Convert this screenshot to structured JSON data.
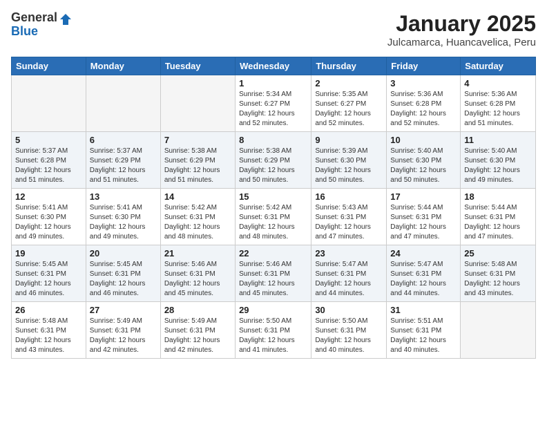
{
  "logo": {
    "general": "General",
    "blue": "Blue"
  },
  "header": {
    "month": "January 2025",
    "location": "Julcamarca, Huancavelica, Peru"
  },
  "weekdays": [
    "Sunday",
    "Monday",
    "Tuesday",
    "Wednesday",
    "Thursday",
    "Friday",
    "Saturday"
  ],
  "weeks": [
    [
      {
        "day": "",
        "info": ""
      },
      {
        "day": "",
        "info": ""
      },
      {
        "day": "",
        "info": ""
      },
      {
        "day": "1",
        "info": "Sunrise: 5:34 AM\nSunset: 6:27 PM\nDaylight: 12 hours\nand 52 minutes."
      },
      {
        "day": "2",
        "info": "Sunrise: 5:35 AM\nSunset: 6:27 PM\nDaylight: 12 hours\nand 52 minutes."
      },
      {
        "day": "3",
        "info": "Sunrise: 5:36 AM\nSunset: 6:28 PM\nDaylight: 12 hours\nand 52 minutes."
      },
      {
        "day": "4",
        "info": "Sunrise: 5:36 AM\nSunset: 6:28 PM\nDaylight: 12 hours\nand 51 minutes."
      }
    ],
    [
      {
        "day": "5",
        "info": "Sunrise: 5:37 AM\nSunset: 6:28 PM\nDaylight: 12 hours\nand 51 minutes."
      },
      {
        "day": "6",
        "info": "Sunrise: 5:37 AM\nSunset: 6:29 PM\nDaylight: 12 hours\nand 51 minutes."
      },
      {
        "day": "7",
        "info": "Sunrise: 5:38 AM\nSunset: 6:29 PM\nDaylight: 12 hours\nand 51 minutes."
      },
      {
        "day": "8",
        "info": "Sunrise: 5:38 AM\nSunset: 6:29 PM\nDaylight: 12 hours\nand 50 minutes."
      },
      {
        "day": "9",
        "info": "Sunrise: 5:39 AM\nSunset: 6:30 PM\nDaylight: 12 hours\nand 50 minutes."
      },
      {
        "day": "10",
        "info": "Sunrise: 5:40 AM\nSunset: 6:30 PM\nDaylight: 12 hours\nand 50 minutes."
      },
      {
        "day": "11",
        "info": "Sunrise: 5:40 AM\nSunset: 6:30 PM\nDaylight: 12 hours\nand 49 minutes."
      }
    ],
    [
      {
        "day": "12",
        "info": "Sunrise: 5:41 AM\nSunset: 6:30 PM\nDaylight: 12 hours\nand 49 minutes."
      },
      {
        "day": "13",
        "info": "Sunrise: 5:41 AM\nSunset: 6:30 PM\nDaylight: 12 hours\nand 49 minutes."
      },
      {
        "day": "14",
        "info": "Sunrise: 5:42 AM\nSunset: 6:31 PM\nDaylight: 12 hours\nand 48 minutes."
      },
      {
        "day": "15",
        "info": "Sunrise: 5:42 AM\nSunset: 6:31 PM\nDaylight: 12 hours\nand 48 minutes."
      },
      {
        "day": "16",
        "info": "Sunrise: 5:43 AM\nSunset: 6:31 PM\nDaylight: 12 hours\nand 47 minutes."
      },
      {
        "day": "17",
        "info": "Sunrise: 5:44 AM\nSunset: 6:31 PM\nDaylight: 12 hours\nand 47 minutes."
      },
      {
        "day": "18",
        "info": "Sunrise: 5:44 AM\nSunset: 6:31 PM\nDaylight: 12 hours\nand 47 minutes."
      }
    ],
    [
      {
        "day": "19",
        "info": "Sunrise: 5:45 AM\nSunset: 6:31 PM\nDaylight: 12 hours\nand 46 minutes."
      },
      {
        "day": "20",
        "info": "Sunrise: 5:45 AM\nSunset: 6:31 PM\nDaylight: 12 hours\nand 46 minutes."
      },
      {
        "day": "21",
        "info": "Sunrise: 5:46 AM\nSunset: 6:31 PM\nDaylight: 12 hours\nand 45 minutes."
      },
      {
        "day": "22",
        "info": "Sunrise: 5:46 AM\nSunset: 6:31 PM\nDaylight: 12 hours\nand 45 minutes."
      },
      {
        "day": "23",
        "info": "Sunrise: 5:47 AM\nSunset: 6:31 PM\nDaylight: 12 hours\nand 44 minutes."
      },
      {
        "day": "24",
        "info": "Sunrise: 5:47 AM\nSunset: 6:31 PM\nDaylight: 12 hours\nand 44 minutes."
      },
      {
        "day": "25",
        "info": "Sunrise: 5:48 AM\nSunset: 6:31 PM\nDaylight: 12 hours\nand 43 minutes."
      }
    ],
    [
      {
        "day": "26",
        "info": "Sunrise: 5:48 AM\nSunset: 6:31 PM\nDaylight: 12 hours\nand 43 minutes."
      },
      {
        "day": "27",
        "info": "Sunrise: 5:49 AM\nSunset: 6:31 PM\nDaylight: 12 hours\nand 42 minutes."
      },
      {
        "day": "28",
        "info": "Sunrise: 5:49 AM\nSunset: 6:31 PM\nDaylight: 12 hours\nand 42 minutes."
      },
      {
        "day": "29",
        "info": "Sunrise: 5:50 AM\nSunset: 6:31 PM\nDaylight: 12 hours\nand 41 minutes."
      },
      {
        "day": "30",
        "info": "Sunrise: 5:50 AM\nSunset: 6:31 PM\nDaylight: 12 hours\nand 40 minutes."
      },
      {
        "day": "31",
        "info": "Sunrise: 5:51 AM\nSunset: 6:31 PM\nDaylight: 12 hours\nand 40 minutes."
      },
      {
        "day": "",
        "info": ""
      }
    ]
  ]
}
